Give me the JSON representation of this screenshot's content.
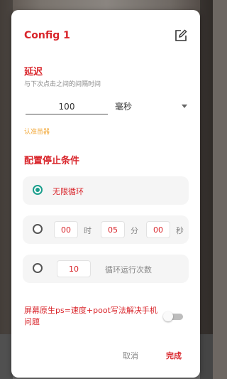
{
  "dialog": {
    "title": "Config 1",
    "edit_icon": "edit-icon"
  },
  "delay": {
    "heading": "延迟",
    "description": "与下次点击之间的间隔时间",
    "value": "100",
    "unit": "毫秒",
    "calibrate_label": "认准苗器"
  },
  "stop": {
    "heading": "配置停止条件",
    "infinite_label": "无限循环",
    "time": {
      "hours": "00",
      "hours_unit": "时",
      "minutes": "05",
      "minutes_unit": "分",
      "seconds": "00",
      "seconds_unit": "秒"
    },
    "count": {
      "value": "10",
      "label": "循环运行次数"
    },
    "selected": "infinite"
  },
  "hint": {
    "text": "屏幕原生ps=速度+poot写法解决手机问题",
    "toggle_on": false
  },
  "actions": {
    "cancel": "取消",
    "done": "完成"
  },
  "colors": {
    "accent": "#d9252b",
    "radio_checked": "#1a9e8c",
    "calibrate": "#f2a93b"
  }
}
